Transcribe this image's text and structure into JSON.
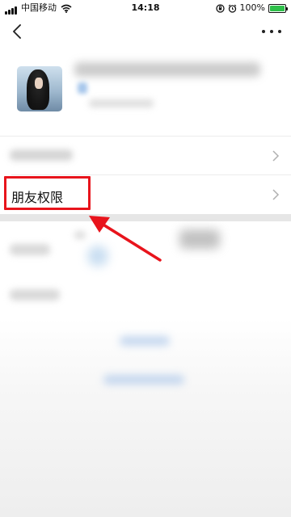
{
  "status_bar": {
    "carrier": "中国移动",
    "time": "14:18",
    "battery_percent": "100%",
    "battery_level": 1.0,
    "battery_color": "#2ec04a"
  },
  "nav": {
    "back_icon": "chevron-left-icon",
    "more_icon": "more-dots-icon"
  },
  "list": {
    "friend_permissions_label": "朋友权限"
  },
  "annotation": {
    "highlight_color": "#e8141c",
    "arrow_color": "#e8141c"
  }
}
